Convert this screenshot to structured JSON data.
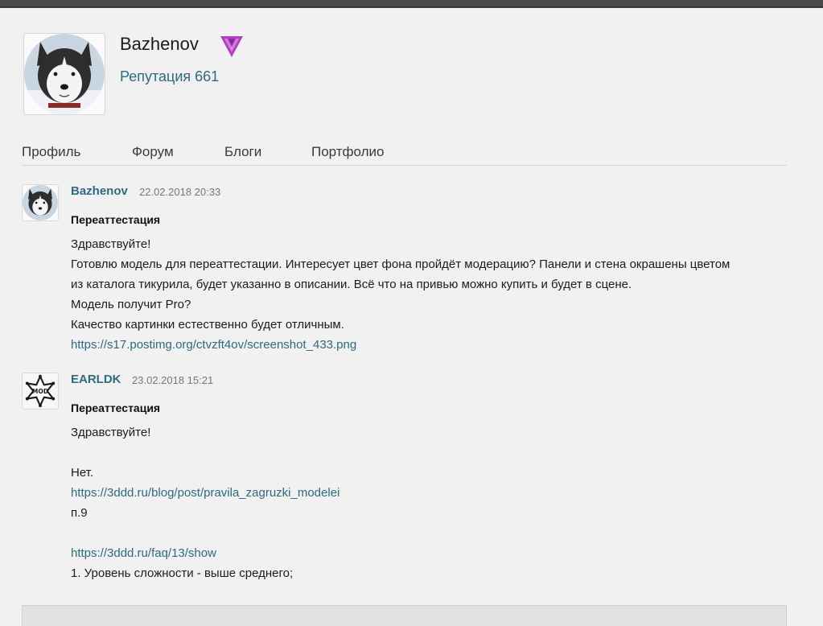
{
  "profile": {
    "username": "Bazhenov",
    "reputation": "Репутация 661",
    "badge_icon": "pro-badge-icon",
    "accent_color": "#2d6b82",
    "badge_color": "#b43fbf"
  },
  "nav": {
    "items": [
      {
        "label": "Профиль"
      },
      {
        "label": "Форум"
      },
      {
        "label": "Блоги"
      },
      {
        "label": "Портфолио"
      }
    ]
  },
  "posts": [
    {
      "author": "Bazhenov",
      "date": "22.02.2018 20:33",
      "title": "Переаттестация",
      "avatar_icon": "husky-avatar-icon",
      "lines": [
        "Здравствуйте!",
        "Готовлю модель для переаттестации. Интересует цвет фона пройдёт модерацию? Панели и стена окрашены цветом",
        "из каталога тикурила, будет указанно в описании. Всё что на привью можно купить и будет в сцене.",
        "Модель получит Pro?",
        "Качество картинки естественно будет отличным.",
        "https://s17.postimg.org/ctvzft4ov/screenshot_433.png"
      ]
    },
    {
      "author": "EARLDK",
      "date": "23.02.2018 15:21",
      "title": "Переаттестация",
      "avatar_icon": "mod-sheriff-star-icon",
      "avatar_text": "MOD",
      "lines": [
        "Здравствуйте!",
        "",
        "Нет.",
        "https://3ddd.ru/blog/post/pravila_zagruzki_modelei",
        "п.9",
        "",
        "https://3ddd.ru/faq/13/show",
        "1. Уровень сложности - выше среднего;"
      ]
    }
  ]
}
